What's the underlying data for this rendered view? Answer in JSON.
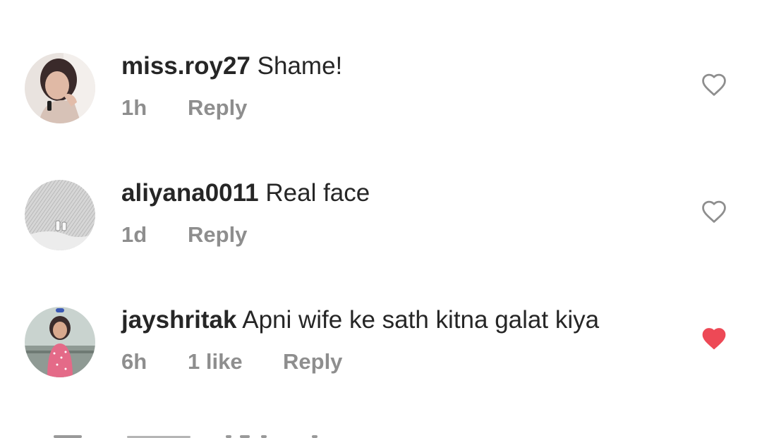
{
  "comments": [
    {
      "username": "miss.roy27",
      "text": "Shame!",
      "time": "1h",
      "likes": "",
      "reply_label": "Reply",
      "liked": false,
      "avatar_icon": "user-photo-avatar"
    },
    {
      "username": "aliyana0011",
      "text": "Real face",
      "time": "1d",
      "likes": "",
      "reply_label": "Reply",
      "liked": false,
      "avatar_icon": "sketch-avatar"
    },
    {
      "username": "jayshritak",
      "text": "Apni wife ke sath kitna galat kiya",
      "time": "6h",
      "likes": "1 like",
      "reply_label": "Reply",
      "liked": true,
      "avatar_icon": "user-photo-avatar"
    }
  ],
  "colors": {
    "username": "#262626",
    "meta": "#8e8e8e",
    "heart_outline": "#8e8e8e",
    "heart_liked": "#ed4956"
  }
}
